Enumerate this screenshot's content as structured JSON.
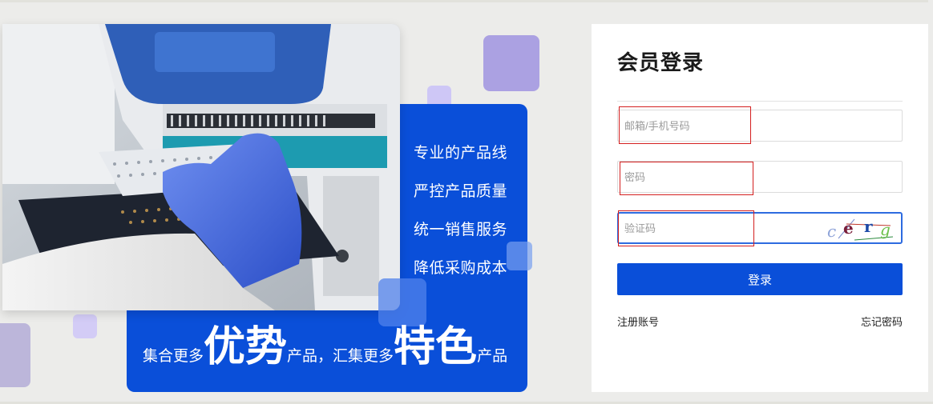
{
  "banner": {
    "features": [
      "专业的产品线",
      "严控产品质量",
      "统一销售服务",
      "降低采购成本"
    ],
    "slogan": {
      "part1": "集合更多",
      "highlight1": "优势",
      "part2": "产品，汇集更多",
      "highlight2": "特色",
      "part3": "产品"
    },
    "colors": {
      "panel": "#0a4fd9",
      "accent": "#aba1e2"
    }
  },
  "login": {
    "title": "会员登录",
    "email_placeholder": "邮箱/手机号码",
    "email_value": "",
    "password_placeholder": "密码",
    "password_value": "",
    "captcha_placeholder": "验证码",
    "captcha_value": "",
    "captcha_text": "cerg",
    "submit_label": "登录",
    "register_link": "注册账号",
    "forgot_link": "忘记密码",
    "colors": {
      "button": "#0a4fd9",
      "focus_border": "#2d6be0"
    }
  }
}
